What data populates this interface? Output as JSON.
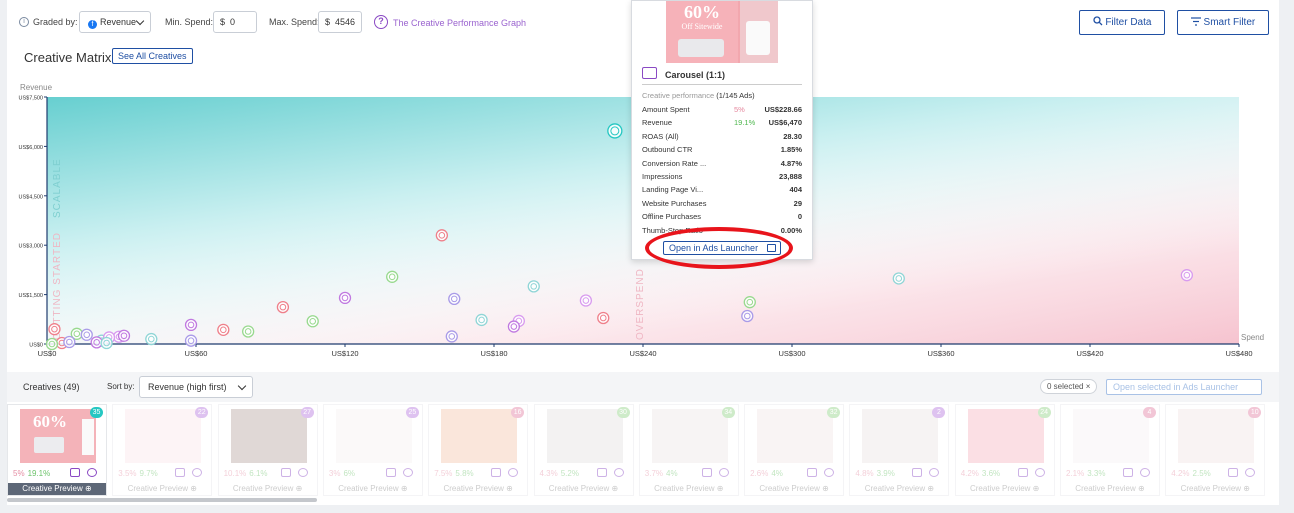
{
  "toolbar": {
    "graded_by_label": "Graded by:",
    "graded_by_value": "Revenue",
    "min_spend_label": "Min. Spend:",
    "min_spend_currency": "$",
    "min_spend_value": "0",
    "max_spend_label": "Max. Spend:",
    "max_spend_currency": "$",
    "max_spend_value": "4546",
    "help_link": "The Creative Performance Graph",
    "filter_data": "Filter Data",
    "smart_filter": "Smart Filter"
  },
  "matrix": {
    "title": "Creative Matrix",
    "see_all": "See All Creatives"
  },
  "chart_data": {
    "type": "scatter",
    "xlabel": "Spend",
    "ylabel": "Revenue",
    "x_ticks": [
      "US$0",
      "US$60",
      "US$120",
      "US$180",
      "US$240",
      "US$300",
      "US$360",
      "US$420",
      "US$480"
    ],
    "y_ticks": [
      "US$0",
      "US$1,500",
      "US$3,000",
      "US$4,500",
      "US$6,000",
      "US$7,500"
    ],
    "xlim": [
      0,
      480
    ],
    "ylim": [
      0,
      7500
    ],
    "zones": [
      "SCALABLE",
      "GETTING STARTED",
      "OVERSPEND"
    ],
    "points": [
      {
        "x": 228.66,
        "y": 6470,
        "highlight": true
      },
      {
        "x": 159,
        "y": 3300
      },
      {
        "x": 139,
        "y": 2040
      },
      {
        "x": 164,
        "y": 1370
      },
      {
        "x": 196,
        "y": 1750
      },
      {
        "x": 217,
        "y": 1320
      },
      {
        "x": 120,
        "y": 1400
      },
      {
        "x": 95,
        "y": 1120
      },
      {
        "x": 107,
        "y": 690
      },
      {
        "x": 163,
        "y": 230
      },
      {
        "x": 175,
        "y": 730
      },
      {
        "x": 190,
        "y": 700
      },
      {
        "x": 188,
        "y": 530
      },
      {
        "x": 224,
        "y": 790
      },
      {
        "x": 283,
        "y": 1270
      },
      {
        "x": 282,
        "y": 850
      },
      {
        "x": 343,
        "y": 1990
      },
      {
        "x": 459,
        "y": 2090
      },
      {
        "x": 58,
        "y": 580
      },
      {
        "x": 71,
        "y": 430
      },
      {
        "x": 81,
        "y": 380
      },
      {
        "x": 58,
        "y": 100
      },
      {
        "x": 42,
        "y": 150
      },
      {
        "x": 29,
        "y": 220
      },
      {
        "x": 31,
        "y": 250
      },
      {
        "x": 3,
        "y": 450
      },
      {
        "x": 12,
        "y": 310
      },
      {
        "x": 16,
        "y": 280
      },
      {
        "x": 22,
        "y": 100
      },
      {
        "x": 25,
        "y": 200
      },
      {
        "x": 20,
        "y": 50
      },
      {
        "x": 6,
        "y": 30
      },
      {
        "x": 2,
        "y": 0
      },
      {
        "x": 9,
        "y": 60
      },
      {
        "x": 24,
        "y": 30
      }
    ]
  },
  "popup": {
    "headline": "60%",
    "headline_sub": "Off Sitewide",
    "title": "Carousel   (1:1)",
    "performance_label": "Creative performance",
    "performance_count": "(1/145 Ads)",
    "metrics": [
      {
        "label": "Amount Spent",
        "pct": "5%",
        "value": "US$228.66"
      },
      {
        "label": "Revenue",
        "pct": "19.1%",
        "value": "US$6,470"
      },
      {
        "label": "ROAS (All)",
        "pct": "",
        "value": "28.30"
      },
      {
        "label": "Outbound CTR",
        "pct": "",
        "value": "1.85%"
      },
      {
        "label": "Conversion Rate ...",
        "pct": "",
        "value": "4.87%"
      },
      {
        "label": "Impressions",
        "pct": "",
        "value": "23,888"
      },
      {
        "label": "Landing Page Vi...",
        "pct": "",
        "value": "404"
      },
      {
        "label": "Website Purchases",
        "pct": "",
        "value": "29"
      },
      {
        "label": "Offline Purchases",
        "pct": "",
        "value": "0"
      },
      {
        "label": "Thumb-Stop Ratio",
        "pct": "",
        "value": "0.00%"
      }
    ],
    "launch_button": "Open in Ads Launcher"
  },
  "creatives": {
    "title": "Creatives (49)",
    "sort_label": "Sort by:",
    "sort_value": "Revenue (high first)",
    "selected": "0 selected",
    "open_selected": "Open selected in Ads Launcher",
    "preview_label": "Creative Preview",
    "cards": [
      {
        "rank": "35",
        "a": "5%",
        "b": "19.1%",
        "thumb": "#f4b3b9",
        "badge": "teal"
      },
      {
        "rank": "22",
        "a": "3.5%",
        "b": "9.7%",
        "thumb": "#fbe7ea",
        "badge": "purple"
      },
      {
        "rank": "27",
        "a": "10.1%",
        "b": "6.1%",
        "thumb": "#b7a39f",
        "badge": "purple"
      },
      {
        "rank": "25",
        "a": "3%",
        "b": "6%",
        "thumb": "#f7f1f2",
        "badge": "purple"
      },
      {
        "rank": "16",
        "a": "7.5%",
        "b": "5.8%",
        "thumb": "#f4c4ac",
        "badge": "pink"
      },
      {
        "rank": "30",
        "a": "4.3%",
        "b": "5.2%",
        "thumb": "#e4e1e2",
        "badge": "green"
      },
      {
        "rank": "34",
        "a": "3.7%",
        "b": "4%",
        "thumb": "#eee7e6",
        "badge": "green"
      },
      {
        "rank": "32",
        "a": "2.6%",
        "b": "4%",
        "thumb": "#f1e5e7",
        "badge": "green"
      },
      {
        "rank": "2",
        "a": "4.8%",
        "b": "3.9%",
        "thumb": "#ebe3e4",
        "badge": "purple"
      },
      {
        "rank": "24",
        "a": "4.2%",
        "b": "3.6%",
        "thumb": "#f6b4bf",
        "badge": "green"
      },
      {
        "rank": "4",
        "a": "2.1%",
        "b": "3.3%",
        "thumb": "#f6f3f4",
        "badge": "pink"
      },
      {
        "rank": "10",
        "a": "4.2%",
        "b": "2.5%",
        "thumb": "#f3e3e4",
        "badge": "pink"
      }
    ]
  }
}
